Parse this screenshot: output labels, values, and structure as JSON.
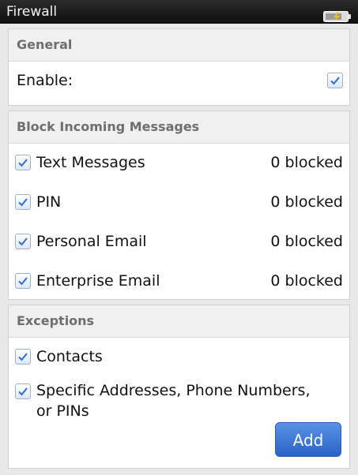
{
  "window": {
    "title": "Firewall",
    "battery_icon": "battery-charging-icon"
  },
  "general": {
    "header": "General",
    "enable_label": "Enable:",
    "enable_checked": true
  },
  "block_incoming": {
    "header": "Block Incoming Messages",
    "items": [
      {
        "label": "Text Messages",
        "status": "0 blocked",
        "checked": true
      },
      {
        "label": "PIN",
        "status": "0 blocked",
        "checked": true
      },
      {
        "label": "Personal Email",
        "status": "0 blocked",
        "checked": true
      },
      {
        "label": "Enterprise Email",
        "status": "0 blocked",
        "checked": true
      }
    ]
  },
  "exceptions": {
    "header": "Exceptions",
    "items": [
      {
        "label": "Contacts",
        "checked": true
      },
      {
        "label": "Specific Addresses, Phone Numbers, or PINs",
        "label_line1": "Specific Addresses, Phone Numbers,",
        "label_line2": "or PINs",
        "checked": true
      }
    ],
    "add_button": "Add"
  },
  "colors": {
    "accent": "#2a63c8",
    "titlebar": "#111111",
    "header_text": "#6e6e6e"
  }
}
